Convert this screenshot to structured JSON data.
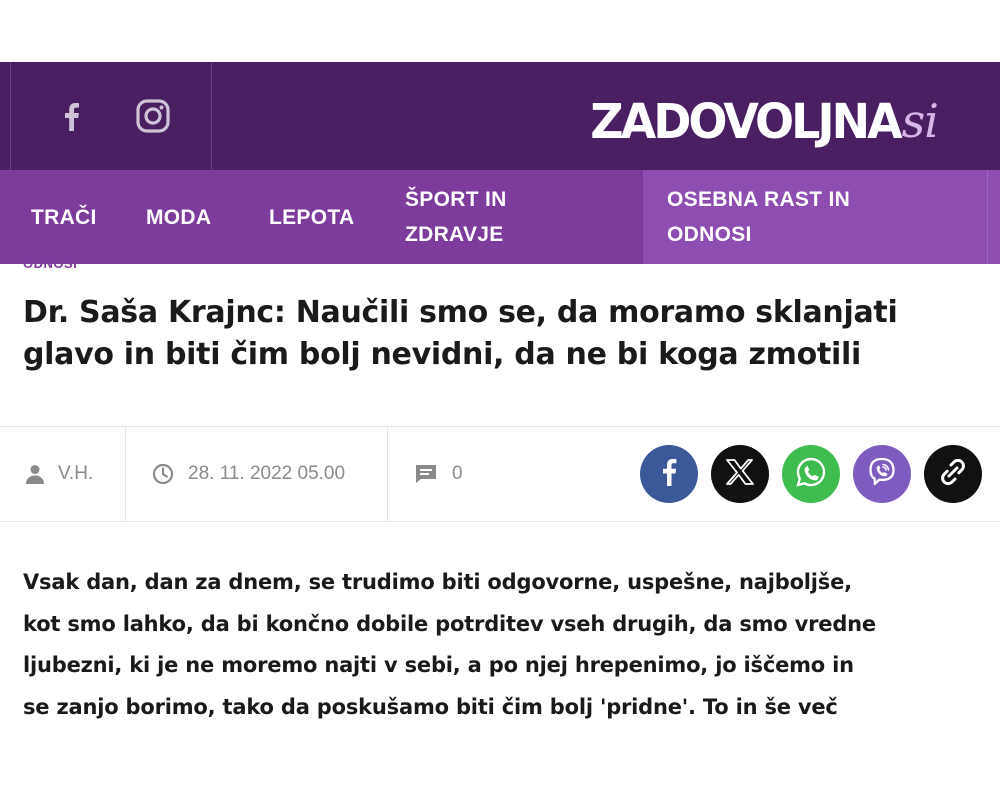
{
  "header": {
    "logo": {
      "main": "ZADOVOLJNA",
      "script": "si"
    },
    "social": [
      {
        "name": "facebook-icon"
      },
      {
        "name": "instagram-icon"
      }
    ]
  },
  "nav": {
    "items": [
      {
        "label": "TRAČI"
      },
      {
        "label": "MODA"
      },
      {
        "label": "LEPOTA"
      },
      {
        "label_line1": "ŠPORT IN",
        "label_line2": "ZDRAVJE"
      },
      {
        "label_line1": "OSEBNA RAST IN",
        "label_line2": "ODNOSI",
        "active": true
      }
    ]
  },
  "article": {
    "category": "ODNOSI",
    "title_line1": "Dr. Saša Krajnc: Naučili smo se, da moramo sklanjati",
    "title_line2": "glavo in biti čim bolj nevidni, da ne bi koga zmotili",
    "meta": {
      "author": "V.H.",
      "date": "28. 11. 2022 05.00",
      "comments": "0"
    },
    "share": [
      {
        "name": "facebook-share",
        "icon": "facebook-icon",
        "color": "#3b5998"
      },
      {
        "name": "x-share",
        "icon": "x-icon",
        "color": "#111111"
      },
      {
        "name": "whatsapp-share",
        "icon": "whatsapp-icon",
        "color": "#3ebd4e"
      },
      {
        "name": "viber-share",
        "icon": "viber-icon",
        "color": "#7d5bbf"
      },
      {
        "name": "copy-link-share",
        "icon": "link-icon",
        "color": "#111111"
      }
    ],
    "body_lines": [
      "Vsak dan, dan za dnem, se trudimo biti odgovorne, uspešne, najboljše,",
      "kot smo lahko, da bi končno dobile potrditev vseh drugih, da smo vredne",
      "ljubezni, ki je ne moremo najti v sebi, a po njej hrepenimo, jo iščemo in",
      "se zanjo borimo, tako da poskušamo biti čim bolj 'pridne'. To in še več"
    ]
  },
  "colors": {
    "header_bg": "#4a1f62",
    "nav_bg": "#7d3b9c",
    "nav_active_bg": "#8e4db0",
    "accent": "#7d3b9c"
  }
}
